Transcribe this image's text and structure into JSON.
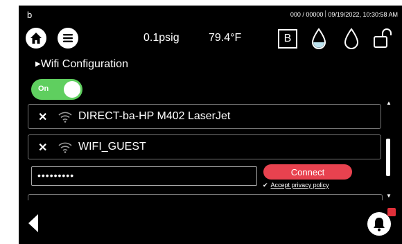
{
  "header": {
    "workstation": "b",
    "counter": "000 / 00000",
    "datetime": "09/19/2022, 10:30:58 AM",
    "pressure": "0.1psig",
    "temperature": "79.4°F",
    "mode": "B"
  },
  "wifi": {
    "section_title": "Wifi Configuration",
    "toggle_label": "On",
    "networks": [
      {
        "ssid": "DIRECT-ba-HP M402 LaserJet"
      },
      {
        "ssid": "WIFI_GUEST"
      }
    ],
    "password_value": "•••••••••",
    "connect_label": "Connect",
    "privacy_label": "Accept privacy policy"
  },
  "icons": {
    "home": "home-icon",
    "menu": "menu-icon",
    "drop_half": "drop-half-filled-icon",
    "drop_outline": "drop-outline-icon",
    "lock": "unlock-icon",
    "wifi": "wifi-icon",
    "back": "back-arrow-icon",
    "bell": "bell-icon"
  },
  "colors": {
    "toggle_on": "#5fcf5f",
    "connect": "#e8424f",
    "alert_badge": "#e0303a",
    "drop_fill": "#bde3ef"
  }
}
